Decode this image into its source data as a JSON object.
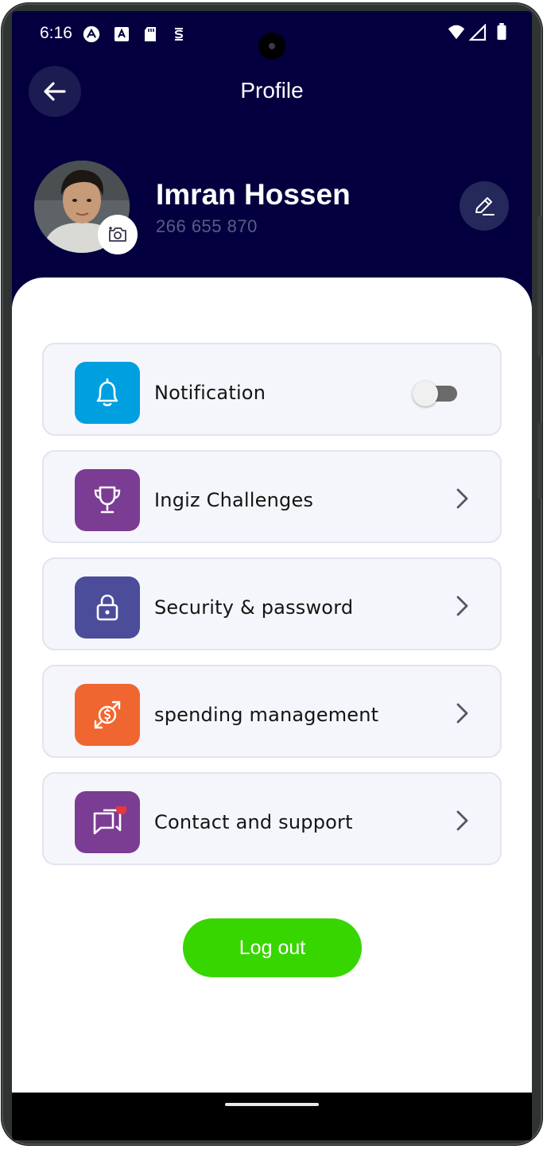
{
  "status_bar": {
    "time": "6:16"
  },
  "header": {
    "title": "Profile"
  },
  "profile": {
    "name": "Imran Hossen",
    "phone": "266 655 870"
  },
  "menu": {
    "items": [
      {
        "label": "Notification",
        "icon": "bell-icon",
        "color": "#009fdf",
        "control": "toggle",
        "toggle_on": false
      },
      {
        "label": "Ingiz Challenges",
        "icon": "trophy-icon",
        "color": "#7b3c93",
        "control": "chevron"
      },
      {
        "label": "Security & password",
        "icon": "lock-icon",
        "color": "#4b4c9a",
        "control": "chevron"
      },
      {
        "label": "spending management",
        "icon": "currency-exchange-icon",
        "color": "#f06630",
        "control": "chevron"
      },
      {
        "label": "Contact and support",
        "icon": "chat-icon",
        "color": "#7b3c93",
        "control": "chevron"
      }
    ]
  },
  "logout": {
    "label": "Log out",
    "color": "#38d600"
  },
  "colors": {
    "header_bg": "#04003f",
    "item_bg": "#f5f6fb"
  }
}
